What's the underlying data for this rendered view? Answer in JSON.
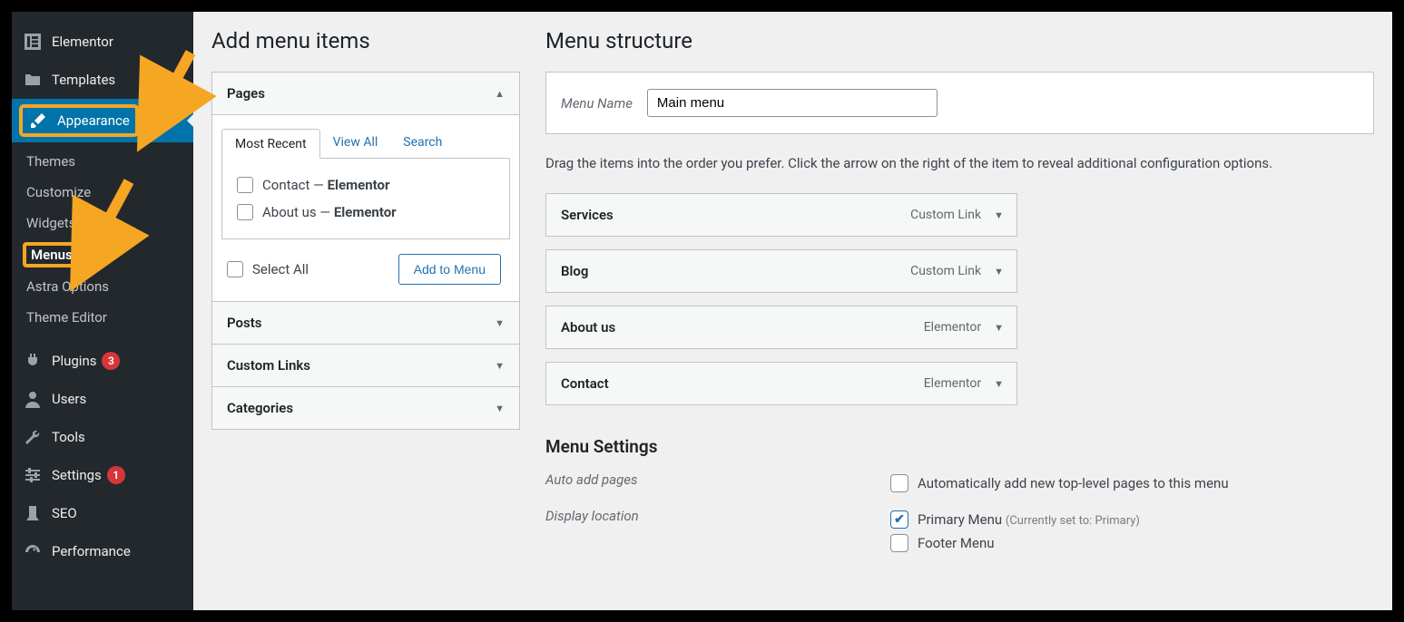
{
  "sidebar": {
    "items": [
      {
        "label": "Elementor",
        "icon": "elementor"
      },
      {
        "label": "Templates",
        "icon": "folder"
      },
      {
        "label": "Appearance",
        "icon": "brush",
        "active": true,
        "highlighted": true
      },
      {
        "label": "Plugins",
        "icon": "plug",
        "badge": "3"
      },
      {
        "label": "Users",
        "icon": "user"
      },
      {
        "label": "Tools",
        "icon": "wrench"
      },
      {
        "label": "Settings",
        "icon": "sliders",
        "badge": "1"
      },
      {
        "label": "SEO",
        "icon": "seo"
      },
      {
        "label": "Performance",
        "icon": "gauge"
      }
    ],
    "subitems": [
      {
        "label": "Themes"
      },
      {
        "label": "Customize"
      },
      {
        "label": "Widgets"
      },
      {
        "label": "Menus",
        "current": true,
        "highlighted": true
      },
      {
        "label": "Astra Options"
      },
      {
        "label": "Theme Editor"
      }
    ]
  },
  "addMenu": {
    "title": "Add menu items",
    "accordion": {
      "pages": {
        "title": "Pages",
        "tabs": {
          "recent": "Most Recent",
          "viewAll": "View All",
          "search": "Search"
        },
        "items": [
          {
            "name": "Contact",
            "type": "Elementor"
          },
          {
            "name": "About us",
            "type": "Elementor"
          }
        ],
        "selectAll": "Select All",
        "addBtn": "Add to Menu"
      },
      "posts": "Posts",
      "customLinks": "Custom Links",
      "categories": "Categories"
    }
  },
  "structure": {
    "title": "Menu structure",
    "menuNameLabel": "Menu Name",
    "menuNameValue": "Main menu",
    "instructions": "Drag the items into the order you prefer. Click the arrow on the right of the item to reveal additional configuration options.",
    "items": [
      {
        "title": "Services",
        "type": "Custom Link"
      },
      {
        "title": "Blog",
        "type": "Custom Link"
      },
      {
        "title": "About us",
        "type": "Elementor"
      },
      {
        "title": "Contact",
        "type": "Elementor"
      }
    ]
  },
  "settings": {
    "title": "Menu Settings",
    "autoAddLabel": "Auto add pages",
    "autoAddOption": "Automatically add new top-level pages to this menu",
    "displayLabel": "Display location",
    "primary": {
      "label": "Primary Menu",
      "note": "(Currently set to: Primary)",
      "checked": true
    },
    "footer": {
      "label": "Footer Menu",
      "checked": false
    }
  }
}
